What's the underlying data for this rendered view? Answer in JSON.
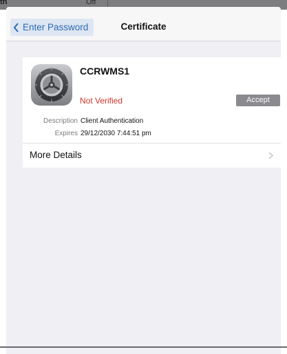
{
  "background": {
    "left_text": "th",
    "mid_text": "Off"
  },
  "navbar": {
    "back_label": "Enter Password",
    "title": "Certificate"
  },
  "certificate": {
    "name": "CCRWMS1",
    "status": "Not Verified",
    "accept_label": "Accept",
    "icon": "gear-icon",
    "details": [
      {
        "key": "Description",
        "value": "Client Authentication"
      },
      {
        "key": "Expires",
        "value": "29/12/2030 7:44:51 pm"
      }
    ],
    "more_details_label": "More Details"
  },
  "colors": {
    "accent": "#2f6bb5",
    "status_error": "#d0362c",
    "accept_button": "#8a8a8f",
    "modal_background": "#efeff4"
  }
}
